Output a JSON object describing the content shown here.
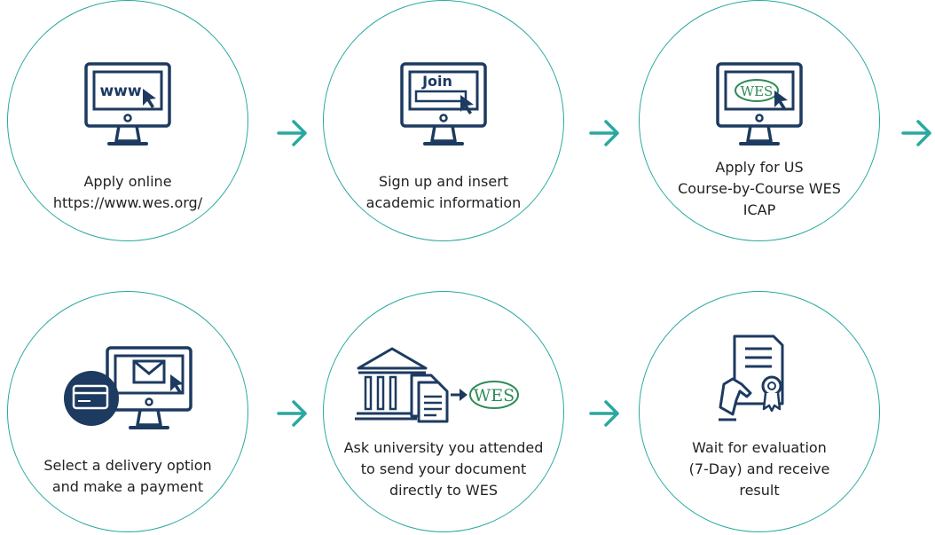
{
  "colors": {
    "accent": "#2aa8a0",
    "navy": "#1d3a60",
    "wes_green": "#2e8b57",
    "text": "#222222"
  },
  "steps": [
    {
      "icon": "monitor-www-icon",
      "screen_text": "www",
      "lines": [
        "Apply online",
        "https://www.wes.org/"
      ]
    },
    {
      "icon": "monitor-join-icon",
      "screen_text": "Join",
      "lines": [
        "Sign up and insert",
        "academic information"
      ]
    },
    {
      "icon": "monitor-wes-icon",
      "screen_text": "WES",
      "lines": [
        "Apply for US",
        "Course-by-Course WES",
        "ICAP"
      ]
    },
    {
      "icon": "monitor-mail-card-icon",
      "lines": [
        "Select a delivery option",
        "and make a payment"
      ]
    },
    {
      "icon": "university-document-wes-icon",
      "screen_text": "WES",
      "lines": [
        "Ask university you attended",
        "to send your document",
        "directly to WES"
      ]
    },
    {
      "icon": "certificate-hand-icon",
      "lines": [
        "Wait for evaluation",
        "(7-Day) and receive",
        "result"
      ]
    }
  ]
}
